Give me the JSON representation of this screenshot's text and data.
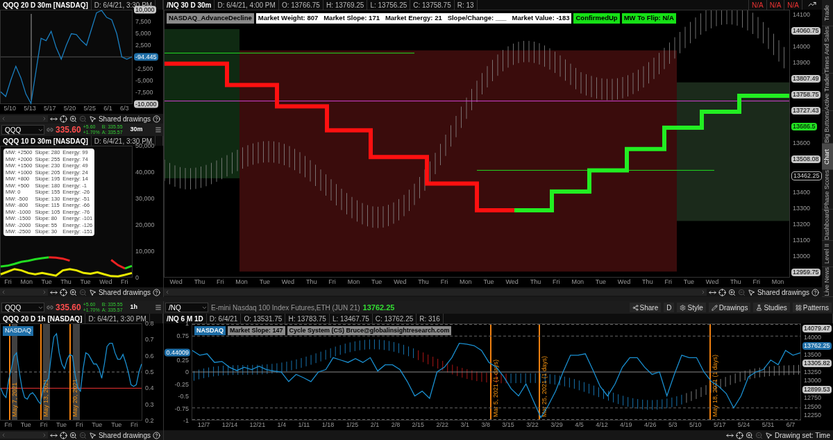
{
  "panel_a": {
    "title": "QQQ 20 D 30m [NASDAQ]",
    "date": "D: 6/4/21, 3:30 PM",
    "current_value": "-94.445",
    "x_ticks": [
      "5/10",
      "5/13",
      "5/17",
      "5/20",
      "5/25",
      "6/1",
      "6/3"
    ],
    "toolbar_label": "Shared drawings",
    "chart_data": {
      "type": "line",
      "ylim": [
        -10000,
        10000
      ],
      "yticks": [
        {
          "value": 10000,
          "label": "10,000"
        },
        {
          "value": 7500,
          "label": "7,500"
        },
        {
          "value": 5000,
          "label": "5,000"
        },
        {
          "value": 2500,
          "label": "2,500"
        },
        {
          "value": -2500,
          "label": "-2,500"
        },
        {
          "value": -5000,
          "label": "-5,000"
        },
        {
          "value": -7500,
          "label": "-7,500"
        },
        {
          "value": -10000,
          "label": "-10,000"
        }
      ],
      "series": [
        {
          "color": "#1a7fc0",
          "values": [
            -7500,
            -8500,
            -5000,
            -2000,
            -4500,
            -8000,
            -10000,
            -3000,
            4000,
            3500,
            5500,
            2000,
            -500,
            2500,
            5000,
            4800,
            3500,
            2500,
            6000,
            9500,
            10000,
            8500,
            8000,
            5000,
            0,
            -500,
            0
          ]
        }
      ]
    }
  },
  "symbol_bar_a": {
    "symbol": "QQQ",
    "price": "335.60",
    "change": "+5.60",
    "change_pct": "+1.70%",
    "bid": "B: 335.55",
    "ask": "A: 335.57",
    "timeframe": "30m"
  },
  "panel_b": {
    "title": "QQQ 10 D 30m [NASDAQ]",
    "date": "D: 6/4/21, 3:30 PM",
    "tooltip_rows": [
      [
        "MW: +2500",
        "Slope: 280",
        "Energy: 99"
      ],
      [
        "MW: +2000",
        "Slope: 255",
        "Energy: 74"
      ],
      [
        "MW: +1500",
        "Slope: 230",
        "Energy: 49"
      ],
      [
        "MW: +1000",
        "Slope: 205",
        "Energy: 24"
      ],
      [
        "MW: +800",
        "Slope: 195",
        "Energy: 14"
      ],
      [
        "MW: +500",
        "Slope: 180",
        "Energy: -1"
      ],
      [
        "MW: 0",
        "Slope: 155",
        "Energy: -26"
      ],
      [
        "MW: -500",
        "Slope: 130",
        "Energy: -51"
      ],
      [
        "MW: -800",
        "Slope: 115",
        "Energy: -66"
      ],
      [
        "MW: -1000",
        "Slope: 105",
        "Energy: -76"
      ],
      [
        "MW: -1500",
        "Slope: 80",
        "Energy: -101"
      ],
      [
        "MW: -2000",
        "Slope: 55",
        "Energy: -126"
      ],
      [
        "MW: -2500",
        "Slope: 30",
        "Energy: -151"
      ]
    ],
    "chart_data": {
      "type": "line",
      "ylim": [
        0,
        50000
      ],
      "yticks": [
        {
          "value": 50000,
          "label": "50,000"
        },
        {
          "value": 40000,
          "label": "40,000"
        },
        {
          "value": 30000,
          "label": "30,000"
        },
        {
          "value": 20000,
          "label": "20,000"
        },
        {
          "value": 10000,
          "label": "10,000"
        },
        {
          "value": 0,
          "label": "0"
        }
      ],
      "series": [
        {
          "color": "#e8e800",
          "values": [
            1000,
            2000,
            3000,
            2500,
            1500,
            1000,
            1500,
            1000,
            500,
            2500,
            3000,
            2500,
            1500,
            1200,
            1800,
            1000,
            300,
            200,
            800,
            1500
          ]
        },
        {
          "color": "#22dd22",
          "values": [
            4000,
            4300,
            5000,
            5800,
            6200,
            6800,
            7200,
            7500,
            null,
            null,
            null,
            null,
            null,
            null,
            null,
            null,
            null,
            null,
            null,
            null
          ]
        },
        {
          "color": "#ee2222",
          "values": [
            null,
            null,
            null,
            null,
            null,
            null,
            null,
            7500,
            7400,
            7000,
            6200,
            null,
            null,
            null,
            null,
            null,
            null,
            null,
            null,
            null
          ]
        },
        {
          "color": "#ee2222",
          "values": [
            null,
            null,
            null,
            null,
            null,
            null,
            null,
            null,
            null,
            null,
            null,
            null,
            null,
            null,
            null,
            null,
            6500,
            4500,
            3200,
            null
          ]
        },
        {
          "color": "#22dd22",
          "values": [
            null,
            null,
            null,
            null,
            null,
            null,
            null,
            null,
            null,
            null,
            null,
            null,
            null,
            null,
            null,
            null,
            null,
            null,
            3200,
            4200
          ]
        }
      ]
    },
    "x_ticks": [
      "Fri",
      "Mon",
      "Tue",
      "Thu",
      "Tue",
      "Wed",
      "Fri"
    ],
    "toolbar_label": "Shared drawings"
  },
  "main_top": {
    "title": "/NQ 30 D 30m",
    "info": [
      "D: 6/4/21, 4:00 PM",
      "O: 13766.75",
      "H: 13769.25",
      "L: 13756.25",
      "C: 13758.75",
      "R: 13"
    ],
    "status": [
      "N/A",
      "N/A",
      "N/A"
    ],
    "labels": [
      {
        "text": "NASDAQ_AdvanceDecline",
        "kind": "name"
      },
      {
        "text": "Market Weight: 807   Market Slope: 171   Market Energy: 21   Slope/Change: ___   Market Value: -183",
        "kind": "stats"
      },
      {
        "text": "ConfirmedUp",
        "kind": "signal"
      },
      {
        "text": "MW To Flip: N/A",
        "kind": "signal"
      }
    ],
    "y_ticks": [
      {
        "text": "14100",
        "kind": "plain"
      },
      {
        "text": "14060.75",
        "kind": "badge"
      },
      {
        "text": "14000",
        "kind": "plain"
      },
      {
        "text": "13900",
        "kind": "plain"
      },
      {
        "text": "13807.49",
        "kind": "badge"
      },
      {
        "text": "13758.75",
        "kind": "badge"
      },
      {
        "text": "13727.43",
        "kind": "badge"
      },
      {
        "text": "13686.5",
        "kind": "highlight"
      },
      {
        "text": "13600",
        "kind": "plain"
      },
      {
        "text": "13508.08",
        "kind": "badge"
      },
      {
        "text": "13462.25",
        "kind": "outline"
      },
      {
        "text": "13400",
        "kind": "plain"
      },
      {
        "text": "13300",
        "kind": "plain"
      },
      {
        "text": "13200",
        "kind": "plain"
      },
      {
        "text": "13100",
        "kind": "plain"
      },
      {
        "text": "13000",
        "kind": "plain"
      },
      {
        "text": "12959.75",
        "kind": "badge"
      }
    ],
    "x_ticks": [
      "Wed",
      "Thu",
      "Fri",
      "Mon",
      "Tue",
      "Wed",
      "Thu",
      "Fri",
      "Mon",
      "Tue",
      "Wed",
      "Thu",
      "Fri",
      "Mon",
      "Tue",
      "Wed",
      "Thu",
      "Fri",
      "Mon",
      "Tue",
      "Wed",
      "Thu",
      "Fri",
      "Tue",
      "Wed",
      "Thu",
      "Fri",
      "Mon"
    ],
    "toolbar_label": "Shared drawings"
  },
  "side_tabs": [
    {
      "label": "Trade",
      "selected": false
    },
    {
      "label": "Times And Sales",
      "selected": false
    },
    {
      "label": "Active Trader",
      "selected": false
    },
    {
      "label": "Big Buttons",
      "selected": false
    },
    {
      "label": "Chart",
      "selected": true
    },
    {
      "label": "Phase Scores",
      "selected": false
    },
    {
      "label": "Dashboard",
      "selected": false
    },
    {
      "label": "Level II",
      "selected": false
    },
    {
      "label": "Live News",
      "selected": false
    }
  ],
  "symbol_bar_c": {
    "symbol": "QQQ",
    "price": "335.60",
    "change": "+5.60",
    "change_pct": "+1.70%",
    "bid": "B: 335.55",
    "ask": "A: 335.57",
    "timeframe": "1h"
  },
  "panel_c": {
    "title": "QQQ 20 D 1h [NASDAQ]",
    "date": "D: 6/4/21, 3:30 PM",
    "badge": "NASDAQ",
    "markers": [
      "May 7, 2021",
      "May 13, 2021",
      "May 20, 2021"
    ],
    "chart_data": {
      "type": "line",
      "ylim": [
        0.2,
        0.8
      ],
      "yticks": [
        {
          "value": 0.8,
          "label": "0.8"
        },
        {
          "value": 0.7,
          "label": "0.7"
        },
        {
          "value": 0.6,
          "label": "0.6"
        },
        {
          "value": 0.5,
          "label": "0.5"
        },
        {
          "value": 0.4,
          "label": "0.4"
        },
        {
          "value": 0.3,
          "label": "0.3"
        },
        {
          "value": 0.2,
          "label": "0.2"
        }
      ],
      "series": [
        {
          "color": "#1a8fd0",
          "values": [
            0.4,
            0.36,
            0.34,
            0.45,
            0.52,
            0.6,
            0.62,
            0.5,
            0.4,
            0.34,
            0.33,
            0.36,
            0.37,
            0.35,
            0.32,
            0.3,
            0.4,
            0.44,
            0.46,
            0.6,
            0.72,
            0.74,
            0.62,
            0.55,
            0.52,
            0.58,
            0.61,
            0.6,
            0.48,
            0.4,
            0.38,
            0.52,
            0.62,
            0.61,
            0.58,
            0.55,
            0.55,
            0.52,
            0.46,
            0.55,
            0.66,
            0.68,
            0.68,
            0.62,
            0.58,
            0.58,
            0.61,
            0.56,
            0.5,
            0.42,
            0.41,
            0.42,
            0.5,
            0.55
          ]
        }
      ]
    },
    "x_ticks": [
      "Fri",
      "Tue",
      "Fri",
      "Tue",
      "Fri",
      "Tue",
      "Tue",
      "Fri"
    ],
    "toolbar_label": "Shared drawings"
  },
  "main_bottom": {
    "symbol": "/NQ",
    "description": "E-mini Nasdaq 100 Index Futures,ETH (JUN 21)",
    "price": "13762.25",
    "buttons": [
      "Share",
      "D",
      "Style",
      "Drawings",
      "Studies",
      "Patterns"
    ],
    "title": "/NQ 6 M 1D",
    "info": [
      "D: 6/4/21",
      "O: 13531.75",
      "H: 13783.75",
      "L: 13467.75",
      "C: 13762.25",
      "R: 316"
    ],
    "labels": [
      {
        "text": "NASDAQ",
        "kind": "name"
      },
      {
        "text": "Market Slope: 147",
        "kind": "stats"
      },
      {
        "text": "Cycle System (CS) Bruce@globalinsightresearch.com",
        "kind": "stats"
      }
    ],
    "markers": [
      "Mar 5, 2021 (1 days)",
      "Mar 25, 2021 (1 days)",
      "May 18, 2021 (1 days)"
    ],
    "current_value": "0.44009",
    "chart_data": {
      "type": "line",
      "ylim": [
        -1,
        1
      ],
      "yticks": [
        {
          "value": 1,
          "label": "1"
        },
        {
          "value": 0.75,
          "label": "0.75"
        },
        {
          "value": 0.25,
          "label": "0.25"
        },
        {
          "value": 0,
          "label": "0"
        },
        {
          "value": -0.25,
          "label": "-0.25"
        },
        {
          "value": -0.5,
          "label": "-0.5"
        },
        {
          "value": -0.75,
          "label": "-0.75"
        },
        {
          "value": -1,
          "label": "-1"
        }
      ],
      "series": [
        {
          "color": "#1a8fd0",
          "values": [
            0.45,
            0.35,
            0.38,
            0.2,
            0.22,
            0.1,
            0.03,
            0.1,
            0.05,
            0.12,
            0.05,
            0.02,
            0.0,
            -0.2,
            -0.05,
            -0.12,
            -0.2,
            0.0,
            0.05,
            0.3,
            0.25,
            0.2,
            0.28,
            0.2,
            0.3,
            0.02,
            0.15,
            0.15,
            0.05,
            -0.2,
            -0.5,
            -0.4,
            -0.55,
            0.0,
            0.1,
            0.3,
            0.6,
            0.58,
            0.55,
            0.45,
            0.2,
            0.1,
            -0.1,
            -0.35,
            -0.5,
            -0.25,
            -0.6,
            -0.95,
            -0.7,
            -0.4,
            0.0,
            0.35,
            0.35,
            0.38,
            0.05,
            -0.3,
            -0.5,
            -0.25,
            0.1,
            0.3,
            0.3,
            0.1,
            -0.05,
            0.0,
            -0.5,
            -0.05,
            0.35,
            0.3,
            0.3,
            0.0,
            -0.2,
            -0.3,
            -0.45,
            -0.75,
            -0.5,
            -0.1,
            0.0,
            0.05,
            0.25,
            0.15,
            0.45,
            0.35,
            0.4
          ]
        }
      ]
    },
    "right_ticks": [
      {
        "text": "14079.47",
        "kind": "badge"
      },
      {
        "text": "14000",
        "kind": "plain"
      },
      {
        "text": "13762.25",
        "kind": "current"
      },
      {
        "text": "13500",
        "kind": "plain"
      },
      {
        "text": "13305.82",
        "kind": "badge"
      },
      {
        "text": "13250",
        "kind": "plain"
      },
      {
        "text": "13000",
        "kind": "plain"
      },
      {
        "text": "12899.53",
        "kind": "badge"
      },
      {
        "text": "12750",
        "kind": "plain"
      },
      {
        "text": "12500",
        "kind": "plain"
      },
      {
        "text": "12250",
        "kind": "plain"
      }
    ],
    "x_ticks": [
      "12/7",
      "12/14",
      "12/21",
      "1/4",
      "1/11",
      "1/18",
      "1/25",
      "2/1",
      "2/8",
      "2/15",
      "2/22",
      "3/1",
      "3/8",
      "3/15",
      "3/22",
      "3/29",
      "4/5",
      "4/12",
      "4/19",
      "4/26",
      "5/3",
      "5/10",
      "5/17",
      "5/24",
      "5/31",
      "6/7"
    ],
    "drawing_set": "Drawing set: Time"
  }
}
